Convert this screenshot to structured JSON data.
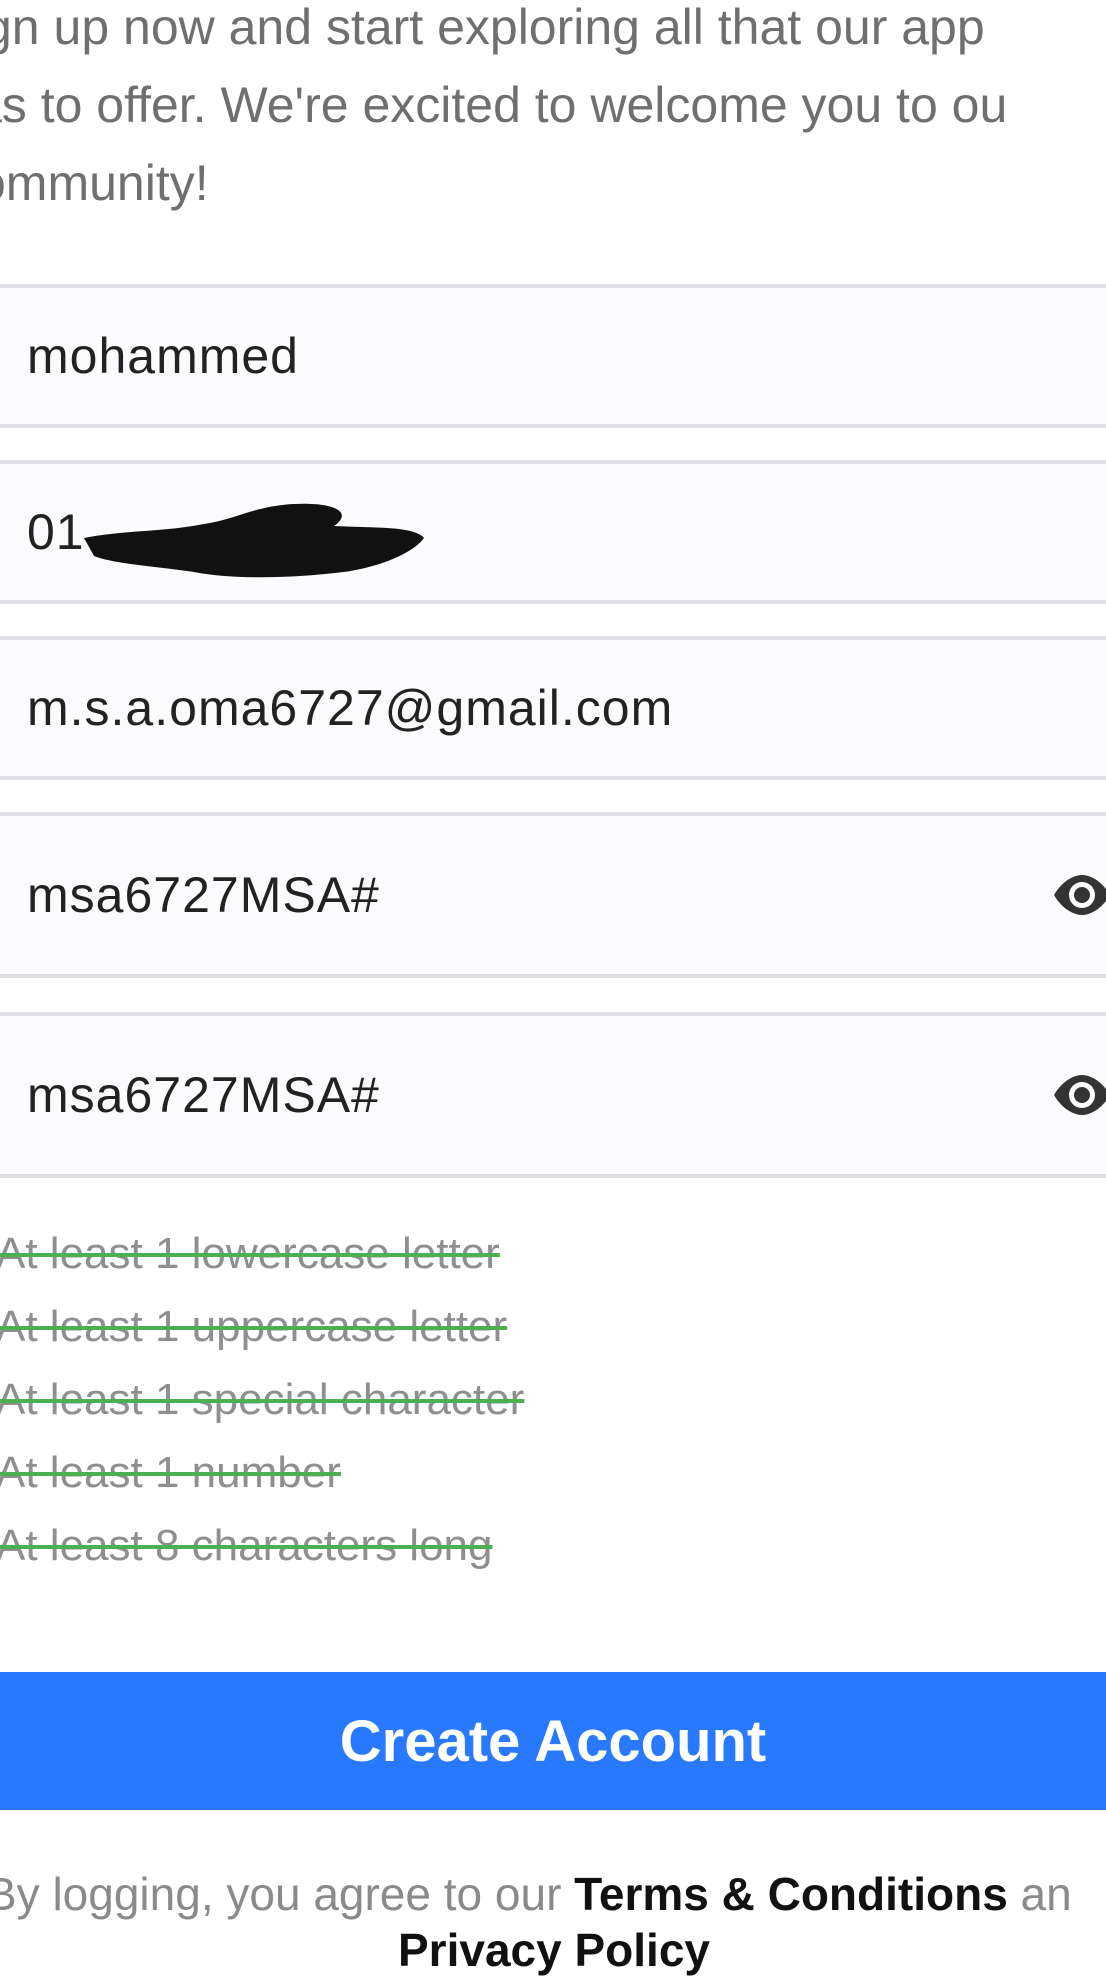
{
  "intro": {
    "line1": "gn up now and start exploring all that our app",
    "line2": "as to offer. We're excited to welcome you to ou",
    "line3": "ommunity!"
  },
  "form": {
    "name": "mohammed",
    "phone": "01",
    "email": "m.s.a.oma6727@gmail.com",
    "password": "msa6727MSA#",
    "confirm_password": "msa6727MSA#"
  },
  "icons": {
    "password_toggle": "eye-icon",
    "confirm_toggle": "eye-icon"
  },
  "rules": [
    "At least 1 lowercase letter",
    "At least 1 uppercase letter",
    "At least 1 special character",
    "At least 1 number",
    "At least 8 characters long"
  ],
  "button": {
    "label": "Create Account"
  },
  "legal": {
    "prefix": "By logging, you agree to our ",
    "terms": "Terms & Conditions",
    "and": " an",
    "privacy": "Privacy Policy"
  },
  "colors": {
    "primary": "#2979ff",
    "rule_strike": "#4caf50",
    "field_bg": "#fbfbfd",
    "field_border": "#dfdfe4"
  }
}
